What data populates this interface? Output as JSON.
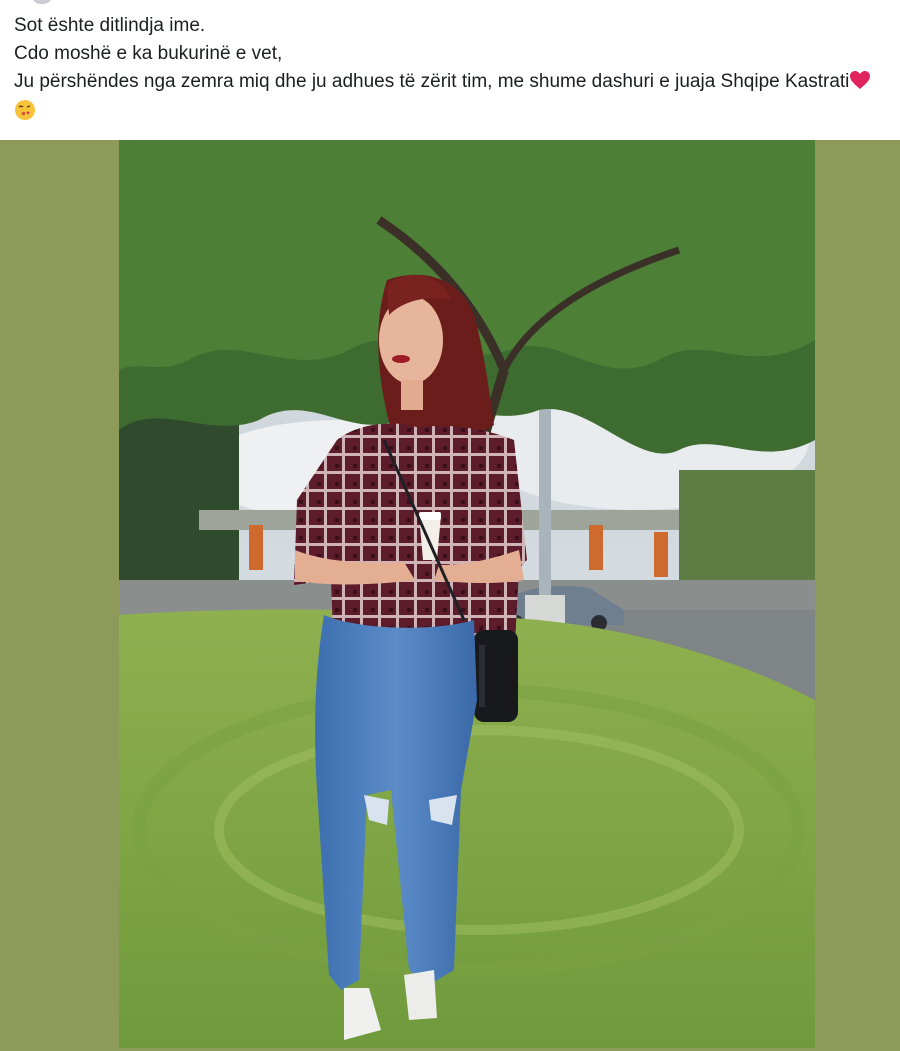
{
  "post": {
    "lines": [
      "Sot ështe ditlindja ime.",
      "Cdo moshë e ka bukurinë e vet,",
      "Ju përshëndes nga zemra miq dhe ju adhues të zërit tim, me shume dashuri e juaja Shqipe Kastrati"
    ],
    "trailing_icons": [
      "red-heart-icon",
      "face-blowing-kiss-icon"
    ]
  },
  "colors": {
    "media_backdrop": "#8e9a5a",
    "text": "#1c1e21",
    "heart": "#e0245e",
    "kiss_face": "#f7c33b"
  }
}
